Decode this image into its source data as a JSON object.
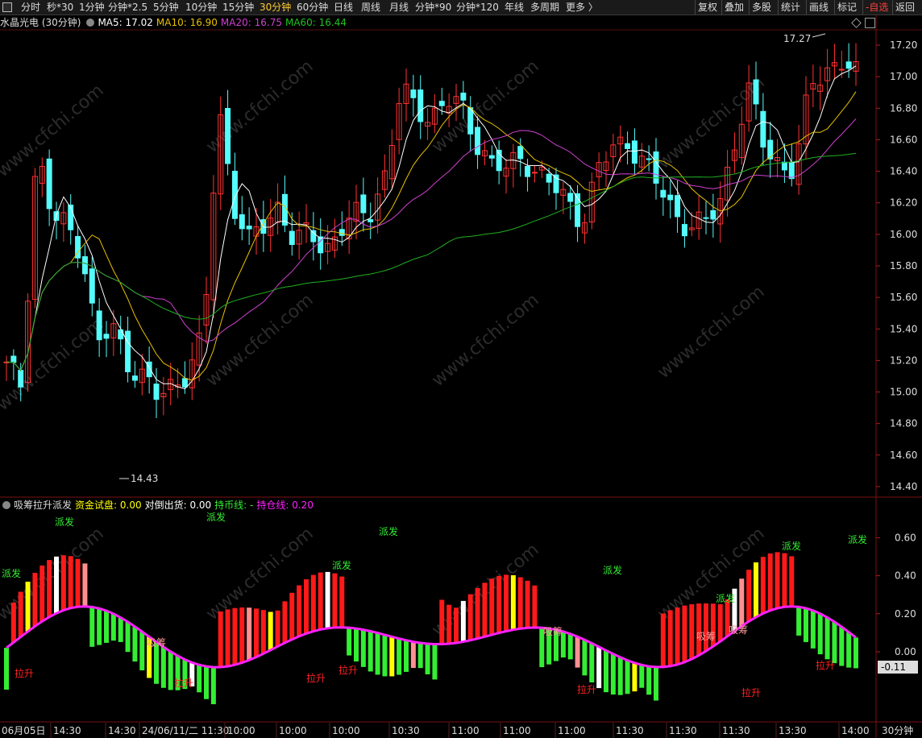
{
  "toolbar": {
    "items": [
      "分时",
      "秒*30",
      "1分钟",
      "分钟*2.5",
      "5分钟",
      "10分钟",
      "15分钟",
      "30分钟",
      "60分钟",
      "日线",
      "周线",
      "月线",
      "分钟*90",
      "分钟*120",
      "年线",
      "多周期",
      "更多 〉"
    ],
    "active_index": 7,
    "right_items": [
      "复权",
      "叠加",
      "多股",
      "统计",
      "画线",
      "标记",
      "-自选",
      "返回"
    ]
  },
  "main": {
    "title": "水晶光电 (30分钟)",
    "ma5_label": "MA5: 17.02",
    "ma10_label": "MA10: 16.90",
    "ma20_label": "MA20: 16.75",
    "ma60_label": "MA60: 16.44",
    "high_label": "17.27",
    "low_label": "14.43",
    "y_ticks": [
      "17.20",
      "17.00",
      "16.80",
      "16.60",
      "16.40",
      "16.20",
      "16.00",
      "15.80",
      "15.60",
      "15.40",
      "15.20",
      "15.00",
      "14.80",
      "14.60",
      "14.40"
    ]
  },
  "indicator": {
    "name": "吸筹拉升派发",
    "fund_label": "资金试盘: 0.00",
    "reverse_label": "对倒出货: 0.00",
    "hold_coin_label": "持币线: -",
    "hold_pos_label": "持仓线: 0.20",
    "y_ticks": [
      "0.60",
      "0.40",
      "0.20",
      "0.00"
    ],
    "current_value": "-0.11",
    "annotations": [
      {
        "text": "派发",
        "color": "green"
      },
      {
        "text": "派发",
        "color": "green"
      },
      {
        "text": "派发",
        "color": "green"
      },
      {
        "text": "派发",
        "color": "green"
      },
      {
        "text": "派发",
        "color": "green"
      },
      {
        "text": "派发",
        "color": "green"
      },
      {
        "text": "派发",
        "color": "green"
      },
      {
        "text": "派发",
        "color": "green"
      },
      {
        "text": "派发",
        "color": "green"
      },
      {
        "text": "吸筹",
        "color": "pink"
      },
      {
        "text": "吸筹",
        "color": "pink"
      },
      {
        "text": "吸筹",
        "color": "pink"
      },
      {
        "text": "吸筹",
        "color": "pink"
      },
      {
        "text": "拉升",
        "color": "red"
      },
      {
        "text": "拉升",
        "color": "red"
      },
      {
        "text": "拉升",
        "color": "red"
      },
      {
        "text": "拉升",
        "color": "red"
      },
      {
        "text": "拉升",
        "color": "red"
      },
      {
        "text": "拉升",
        "color": "red"
      },
      {
        "text": "拉升",
        "color": "red"
      }
    ]
  },
  "time_axis": {
    "labels": [
      "06月05日",
      "14:30",
      "14:30",
      "24/06/11/二 11:30",
      "10:00",
      "10:00",
      "10:00",
      "10:30",
      "11:00",
      "11:00",
      "11:00",
      "11:30",
      "11:30",
      "11:30",
      "13:30",
      "14:00"
    ],
    "period_label": "30分钟"
  },
  "watermark": "www.cfchi.com",
  "colors": {
    "up": "#ff3232",
    "down": "#54fcfc",
    "ma5": "#ffffff",
    "ma10": "#e8c000",
    "ma20": "#d040d0",
    "ma60": "#20b020",
    "bar_red": "#ff1a1a",
    "bar_green": "#33ee33",
    "bar_yellow": "#ffff00",
    "bar_white": "#ffffff",
    "bar_pink": "#ff9090",
    "hold": "#ff20ff"
  }
}
